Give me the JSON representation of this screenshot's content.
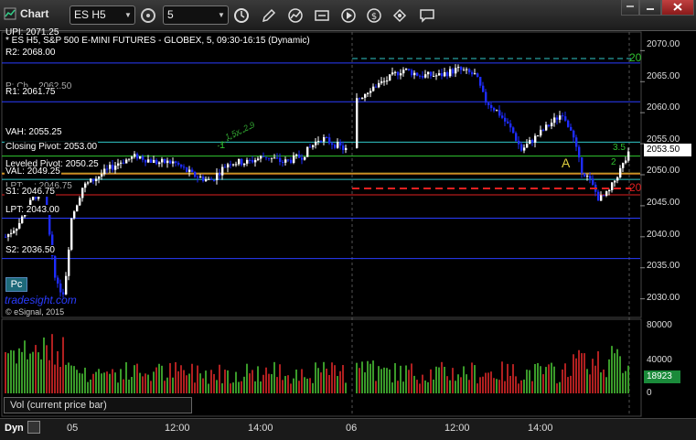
{
  "window": {
    "title": "Chart",
    "symbol": "ES H5",
    "interval": "5"
  },
  "chart": {
    "info_line1": "UPI: 2071.25",
    "info_line2": "* ES H5, S&P 500 E-MINI FUTURES - GLOBEX, 5, 09:30-16:15 (Dynamic)",
    "pivots": [
      {
        "label": "R2: 2068.00",
        "price": 2068.0,
        "color": "#2a3cff"
      },
      {
        "label": "R1: 2061.75",
        "price": 2061.75,
        "color": "#2a3cff"
      },
      {
        "label": "VAH: 2055.25",
        "price": 2055.25,
        "color": "#30c8c8"
      },
      {
        "label": "Closing Pivot: 2053.00",
        "price": 2053.0,
        "color": "#30c830"
      },
      {
        "label": "Leveled Pivot: 2050.25",
        "price": 2050.25,
        "color": "#d8b830"
      },
      {
        "label": "VAL: 2049.25",
        "price": 2049.25,
        "color": "#30c8c8"
      },
      {
        "label": "S1: 2046.75",
        "price": 2046.75,
        "color": "#e02020"
      },
      {
        "label": "LPT: 2043.00",
        "price": 2043.0,
        "color": "#2a3cff"
      },
      {
        "label": "S2: 2036.50",
        "price": 2036.5,
        "color": "#2a3cff"
      }
    ],
    "partial_labels": {
      "pivot_overlap": "P: Ch... 2062.50",
      "lower_overlap": "LPT: ...: 2046.75"
    },
    "last_price": "2053.50",
    "price_ticks": [
      "2070.00",
      "2065.00",
      "2060.00",
      "2055.00",
      "2050.00",
      "2045.00",
      "2040.00",
      "2035.00",
      "2030.00"
    ],
    "volume_ticks": [
      "80000",
      "40000",
      "0"
    ],
    "last_volume": "18923",
    "volume_label": "Vol (current price bar)",
    "time_ticks": [
      "05",
      "12:00",
      "14:00",
      "06",
      "12:00",
      "14:00"
    ],
    "badge": "Pc",
    "brand": "tradesight.com",
    "copyright": "© eSignal, 2015",
    "mode": "Dyn",
    "annotations": {
      "a_marker": "A",
      "one_marker": "1",
      "green_curve": "1.5x..2.9",
      "two_top": "20",
      "two_bottom": "20",
      "three_fifty": "3.5",
      "two_mid": "2"
    },
    "colors": {
      "up_candle": "#ffffff",
      "down_candle": "#1e2cff",
      "vol_up": "#3a9a2a",
      "vol_down": "#b02020"
    },
    "chart_data": {
      "type": "line",
      "title": "* ES H5, S&P 500 E-MINI FUTURES - GLOBEX, 5, 09:30-16:15 (Dynamic)",
      "xlabel": "",
      "ylabel": "",
      "ylim": [
        2027.0,
        2073.0
      ],
      "x": [
        "05",
        "12:00",
        "14:00",
        "06",
        "12:00",
        "14:00"
      ],
      "series": [
        {
          "name": "ES H5",
          "values": [
            2040,
            2053,
            2050,
            2054,
            2067,
            2053.5
          ]
        }
      ]
    }
  }
}
